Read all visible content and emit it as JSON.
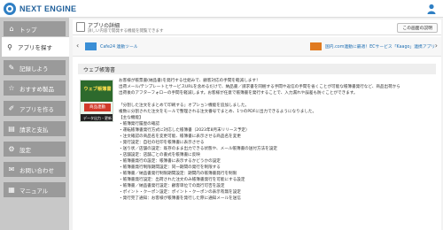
{
  "brand": {
    "name": "NEXT ENGINE"
  },
  "user": {
    "icon": "user-icon"
  },
  "sidebar": {
    "items": [
      {
        "label": "トップ",
        "icon": "home-icon",
        "glyph": "⌂",
        "active": false
      },
      {
        "label": "アプリを探す",
        "icon": "search-icon",
        "glyph": "⚲",
        "active": true
      },
      {
        "label": "記録しよう",
        "icon": "bookmark-icon",
        "glyph": "✎",
        "active": false
      },
      {
        "label": "おすすめ製品",
        "icon": "star-icon",
        "glyph": "☆",
        "active": false
      },
      {
        "label": "アプリを作る",
        "icon": "pencil-icon",
        "glyph": "✐",
        "active": false
      },
      {
        "label": "請求と支払",
        "icon": "document-icon",
        "glyph": "▤",
        "active": false
      },
      {
        "label": "設定",
        "icon": "gear-icon",
        "glyph": "⚙",
        "active": false
      },
      {
        "label": "お問い合わせ",
        "icon": "mail-icon",
        "glyph": "✉",
        "active": false
      },
      {
        "label": "マニュアル",
        "icon": "book-icon",
        "glyph": "▦",
        "active": false
      }
    ]
  },
  "header": {
    "title": "アプリの詳細",
    "subtitle": "詳しい内容で開発する機能を閲覧できます",
    "help_label": "この画面の説明"
  },
  "ads": {
    "left_arrow": "‹",
    "right_arrow": "›",
    "items": [
      {
        "label": "Cafe24 連動ツール",
        "color": "#3a8fd6"
      },
      {
        "label": "国内.com連動に最適！ECサービス「Kaago」連携アプリ",
        "color": "#e07a1f"
      }
    ]
  },
  "app": {
    "name": "ウェブ帳簿書",
    "image": {
      "title": "ウェブ帳簿書",
      "badge": "商品連動",
      "footer": "データ出力・更新"
    },
    "description_lines": [
      "お客様が帳票書(納品書)を発行する仕組みで、顧客対応の手間を軽減します！",
      "出荷メール/テンプレートとサービスURLを含めるだけで、納品書／請求書を同梱する手間や返信の手間を省くことが可能な帳簿書発行など、商品出荷から",
      "出荷後のアフターフォローの手間を軽減します。お客様が任意で帳簿書を発行することで、入力漏れや誤差も防ぐことができます。",
      "",
      "「分割した注文をまとめて印刷する」オプション機能を追加しました。",
      "複数に分割された注文をモールで整理される注文番号でまとめ、1つのPDFに出力できるようになりました。",
      "【主な機能】",
      "・帳簿発行履歴の確認",
      "・運転帳簿書発行方式に対応した帳簿書（2023年8月末リリース予定）",
      "・注文確認の商品名を変更可能、帳簿書に表示させる商品名を変更",
      "・発行設定：自社の社印を帳簿書に表示させる",
      "・送り状／店舗の設定：既存のまま出力できる状態や、メール帳簿書の送付方法を設定",
      "・店舗設定：店舗ごとの書式を帳簿書に反映",
      "・帳簿書発行の設定：帳簿書に表示するかどうかの設定",
      "・帳簿書発行制限期間設定：同一期間の発行を制限する",
      "・帳簿書／納品書発行制限期間設定：期間内の帳簿書発行を制限",
      "・帳簿書発行設定：出荷された注文のみ帳簿書発行を可能にする設定",
      "・帳簿書／納品書発行設定：顧客単位での発行可否を設定",
      "・ポイント・クーポン設定：ポイント・クーポンの表示有無を設定",
      "・発行完了通知：お客様が帳簿書を発行した際に通知メールを送信"
    ]
  }
}
